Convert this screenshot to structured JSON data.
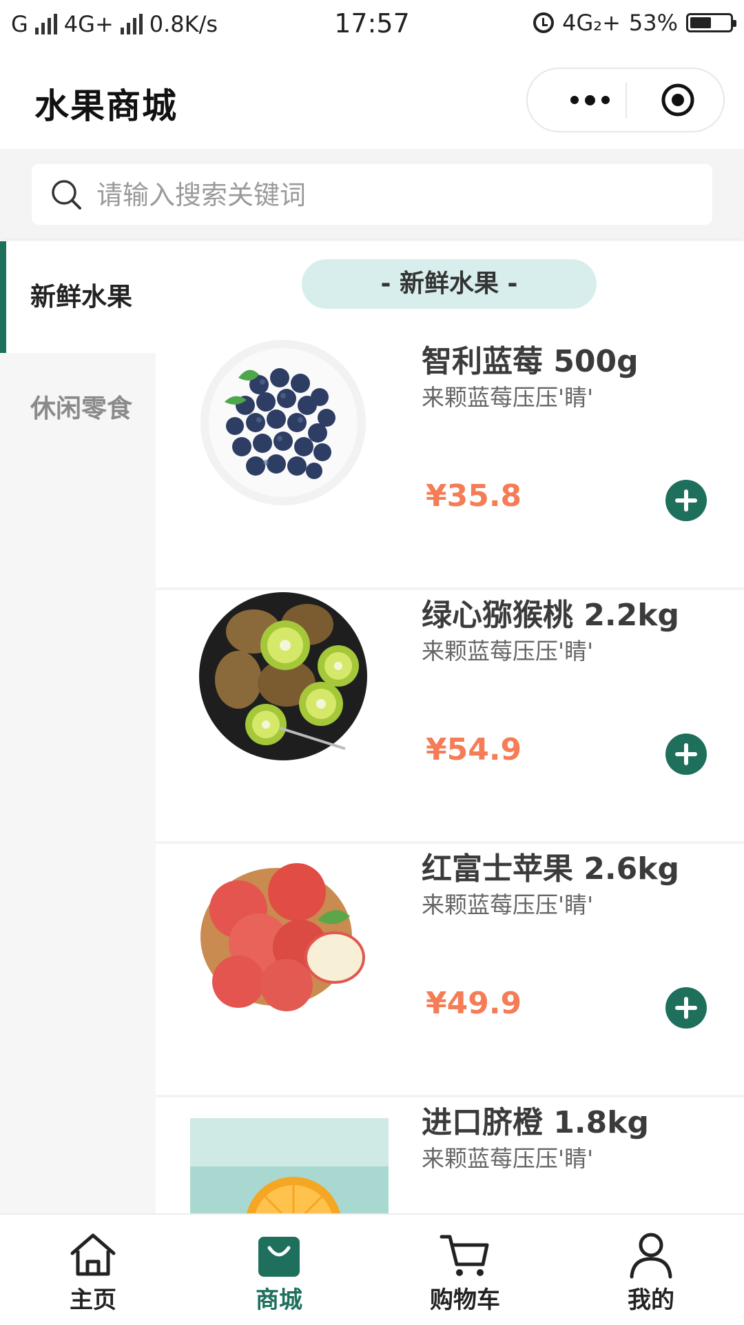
{
  "status_bar": {
    "left_text_1": "G",
    "left_text_2": "4G+",
    "net_speed": "0.8K/s",
    "time": "17:57",
    "network": "4G₂+",
    "battery": "53%",
    "battery_level": 0.53
  },
  "nav": {
    "title": "水果商城"
  },
  "search": {
    "placeholder": "请输入搜索关键词",
    "value": ""
  },
  "sidebar": {
    "items": [
      {
        "label": "新鲜水果",
        "active": true
      },
      {
        "label": "休闲零食",
        "active": false
      }
    ]
  },
  "section_title": "- 新鲜水果 -",
  "products": [
    {
      "name": "智利蓝莓 500g",
      "desc": "来颗蓝莓压压'睛'",
      "price": "¥35.8",
      "image": "blueberries"
    },
    {
      "name": "绿心猕猴桃 2.2kg",
      "desc": "来颗蓝莓压压'睛'",
      "price": "¥54.9",
      "image": "kiwis"
    },
    {
      "name": "红富士苹果 2.6kg",
      "desc": "来颗蓝莓压压'睛'",
      "price": "¥49.9",
      "image": "apples"
    },
    {
      "name": "进口脐橙 1.8kg",
      "desc": "来颗蓝莓压压'睛'",
      "price": "",
      "image": "oranges"
    }
  ],
  "tab_bar": {
    "items": [
      {
        "label": "主页",
        "icon": "home-icon"
      },
      {
        "label": "商城",
        "icon": "shopping-bag-icon",
        "active": true
      },
      {
        "label": "购物车",
        "icon": "cart-icon"
      },
      {
        "label": "我的",
        "icon": "user-icon"
      }
    ]
  },
  "colors": {
    "accent": "#1e6f5c",
    "price": "#f47c56",
    "pill": "#d7eeec"
  }
}
